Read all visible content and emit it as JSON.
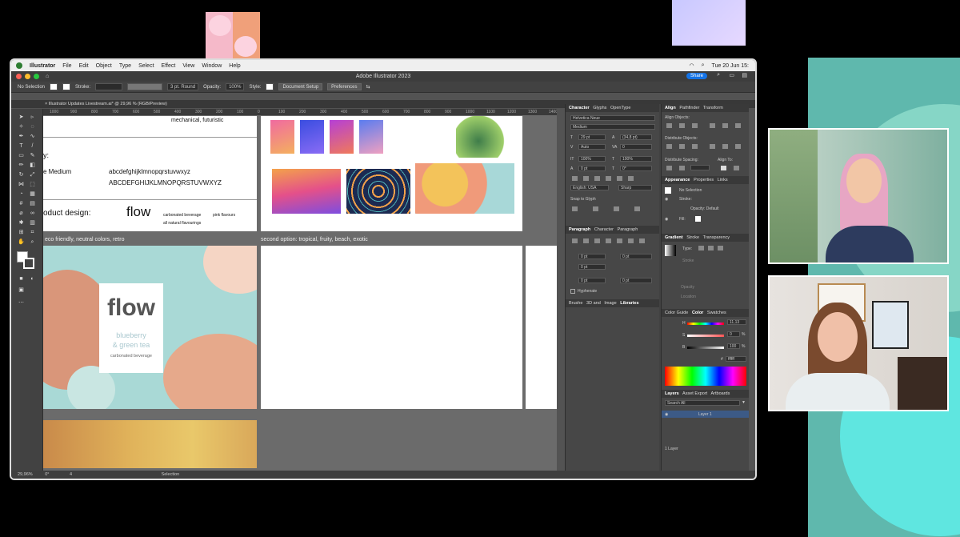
{
  "menubar": {
    "app": "Illustrator",
    "items": [
      "File",
      "Edit",
      "Object",
      "Type",
      "Select",
      "Effect",
      "View",
      "Window",
      "Help"
    ],
    "clock": "Tue 20 Jun  15:"
  },
  "window": {
    "title": "Adobe Illustrator 2023",
    "share_label": "Share"
  },
  "control_bar": {
    "selection": "No Selection",
    "stroke_label": "Stroke:",
    "brush": "3 pt. Round",
    "opacity_label": "Opacity:",
    "opacity_value": "100%",
    "style_label": "Style:",
    "document_setup": "Document Setup",
    "preferences": "Preferences"
  },
  "doc_tab": "Illustrator Updates Livestream.ai* @ 29,96 % (RGB/Preview)",
  "ruler_ticks": [
    "1000",
    "900",
    "800",
    "700",
    "600",
    "500",
    "400",
    "300",
    "200",
    "100",
    "0",
    "100",
    "200",
    "300",
    "400",
    "500",
    "600",
    "700",
    "800",
    "900",
    "1000",
    "1100",
    "1200",
    "1300",
    "1400"
  ],
  "artboards": {
    "top_left": {
      "line1": "mechanical, futuristic",
      "line2": "y:",
      "font_name": "e Medium",
      "lower": "abcdefghijklmnopqrstuvwxyz",
      "upper": "ABCDEFGHIJKLMNOPQRSTUVWXYZ",
      "product": "oduct design:",
      "flow": "flow",
      "bev1": "carbonated beverage",
      "bev2": "pink flavours",
      "bev3": "all natural flavourings"
    },
    "label_first": "eco friendly, neutral colors, retro",
    "label_second": "second option: tropical, fruity, beach, exotic",
    "flow_card": {
      "flow": "flow",
      "line1": "blueberry",
      "line2": "& green tea",
      "line3": "carbonated beverage"
    }
  },
  "statusbar": {
    "zoom": "29,96%",
    "angle": "0°",
    "page": "4",
    "mode": "Selection"
  },
  "character_panel": {
    "tabs": [
      "Character",
      "Glyphs",
      "OpenType"
    ],
    "font": "Helvetica Neue",
    "style": "Medium",
    "size": "29 pt",
    "leading": "(34,8 pt)",
    "tracking": "Auto",
    "kerning": "0",
    "scale_v": "100%",
    "scale_h": "100%",
    "baseline": "0 pt",
    "rotation": "0°",
    "lang": "English: USA",
    "aa": "Sharp",
    "snap": "Snap to Glyph"
  },
  "paragraph_panel": {
    "tabs": [
      "Paragraph",
      "Character",
      "Paragraph"
    ],
    "indent_left": "0 pt",
    "indent_right": "0 pt",
    "first_line": "0 pt",
    "space_before": "0 pt",
    "space_after": "0 pt",
    "hyphenate": "Hyphenate"
  },
  "brushes_tabs": [
    "Brushe",
    "3D and",
    "Image",
    "Libraries"
  ],
  "align_panel": {
    "tabs": [
      "Align",
      "Pathfinder",
      "Transform"
    ],
    "align_objects": "Align Objects:",
    "distribute_objects": "Distribute Objects:",
    "distribute_spacing": "Distribute Spacing:",
    "align_to": "Align To:"
  },
  "appearance_panel": {
    "tabs": [
      "Appearance",
      "Properties",
      "Links"
    ],
    "selection": "No Selection",
    "stroke": "Stroke:",
    "opacity": "Opacity: Default",
    "fill": "Fill:"
  },
  "gradient_panel": {
    "tabs": [
      "Gradient",
      "Stroke",
      "Transparency"
    ],
    "type": "Type:",
    "stroke_label": "Stroke",
    "opacity_label": "Opacity",
    "location_label": "Location"
  },
  "color_panel": {
    "tabs": [
      "Color Guide",
      "Color",
      "Swatches"
    ],
    "h_value": "11,13",
    "s_value": "0",
    "b_value": "100",
    "hex": "ffffff",
    "h": "H",
    "s": "S",
    "b": "B",
    "unit": "%"
  },
  "layers_panel": {
    "tabs": [
      "Layers",
      "Asset Export",
      "Artboards"
    ],
    "search": "Search All",
    "layer": "Layer 1",
    "footer": "1 Layer"
  }
}
